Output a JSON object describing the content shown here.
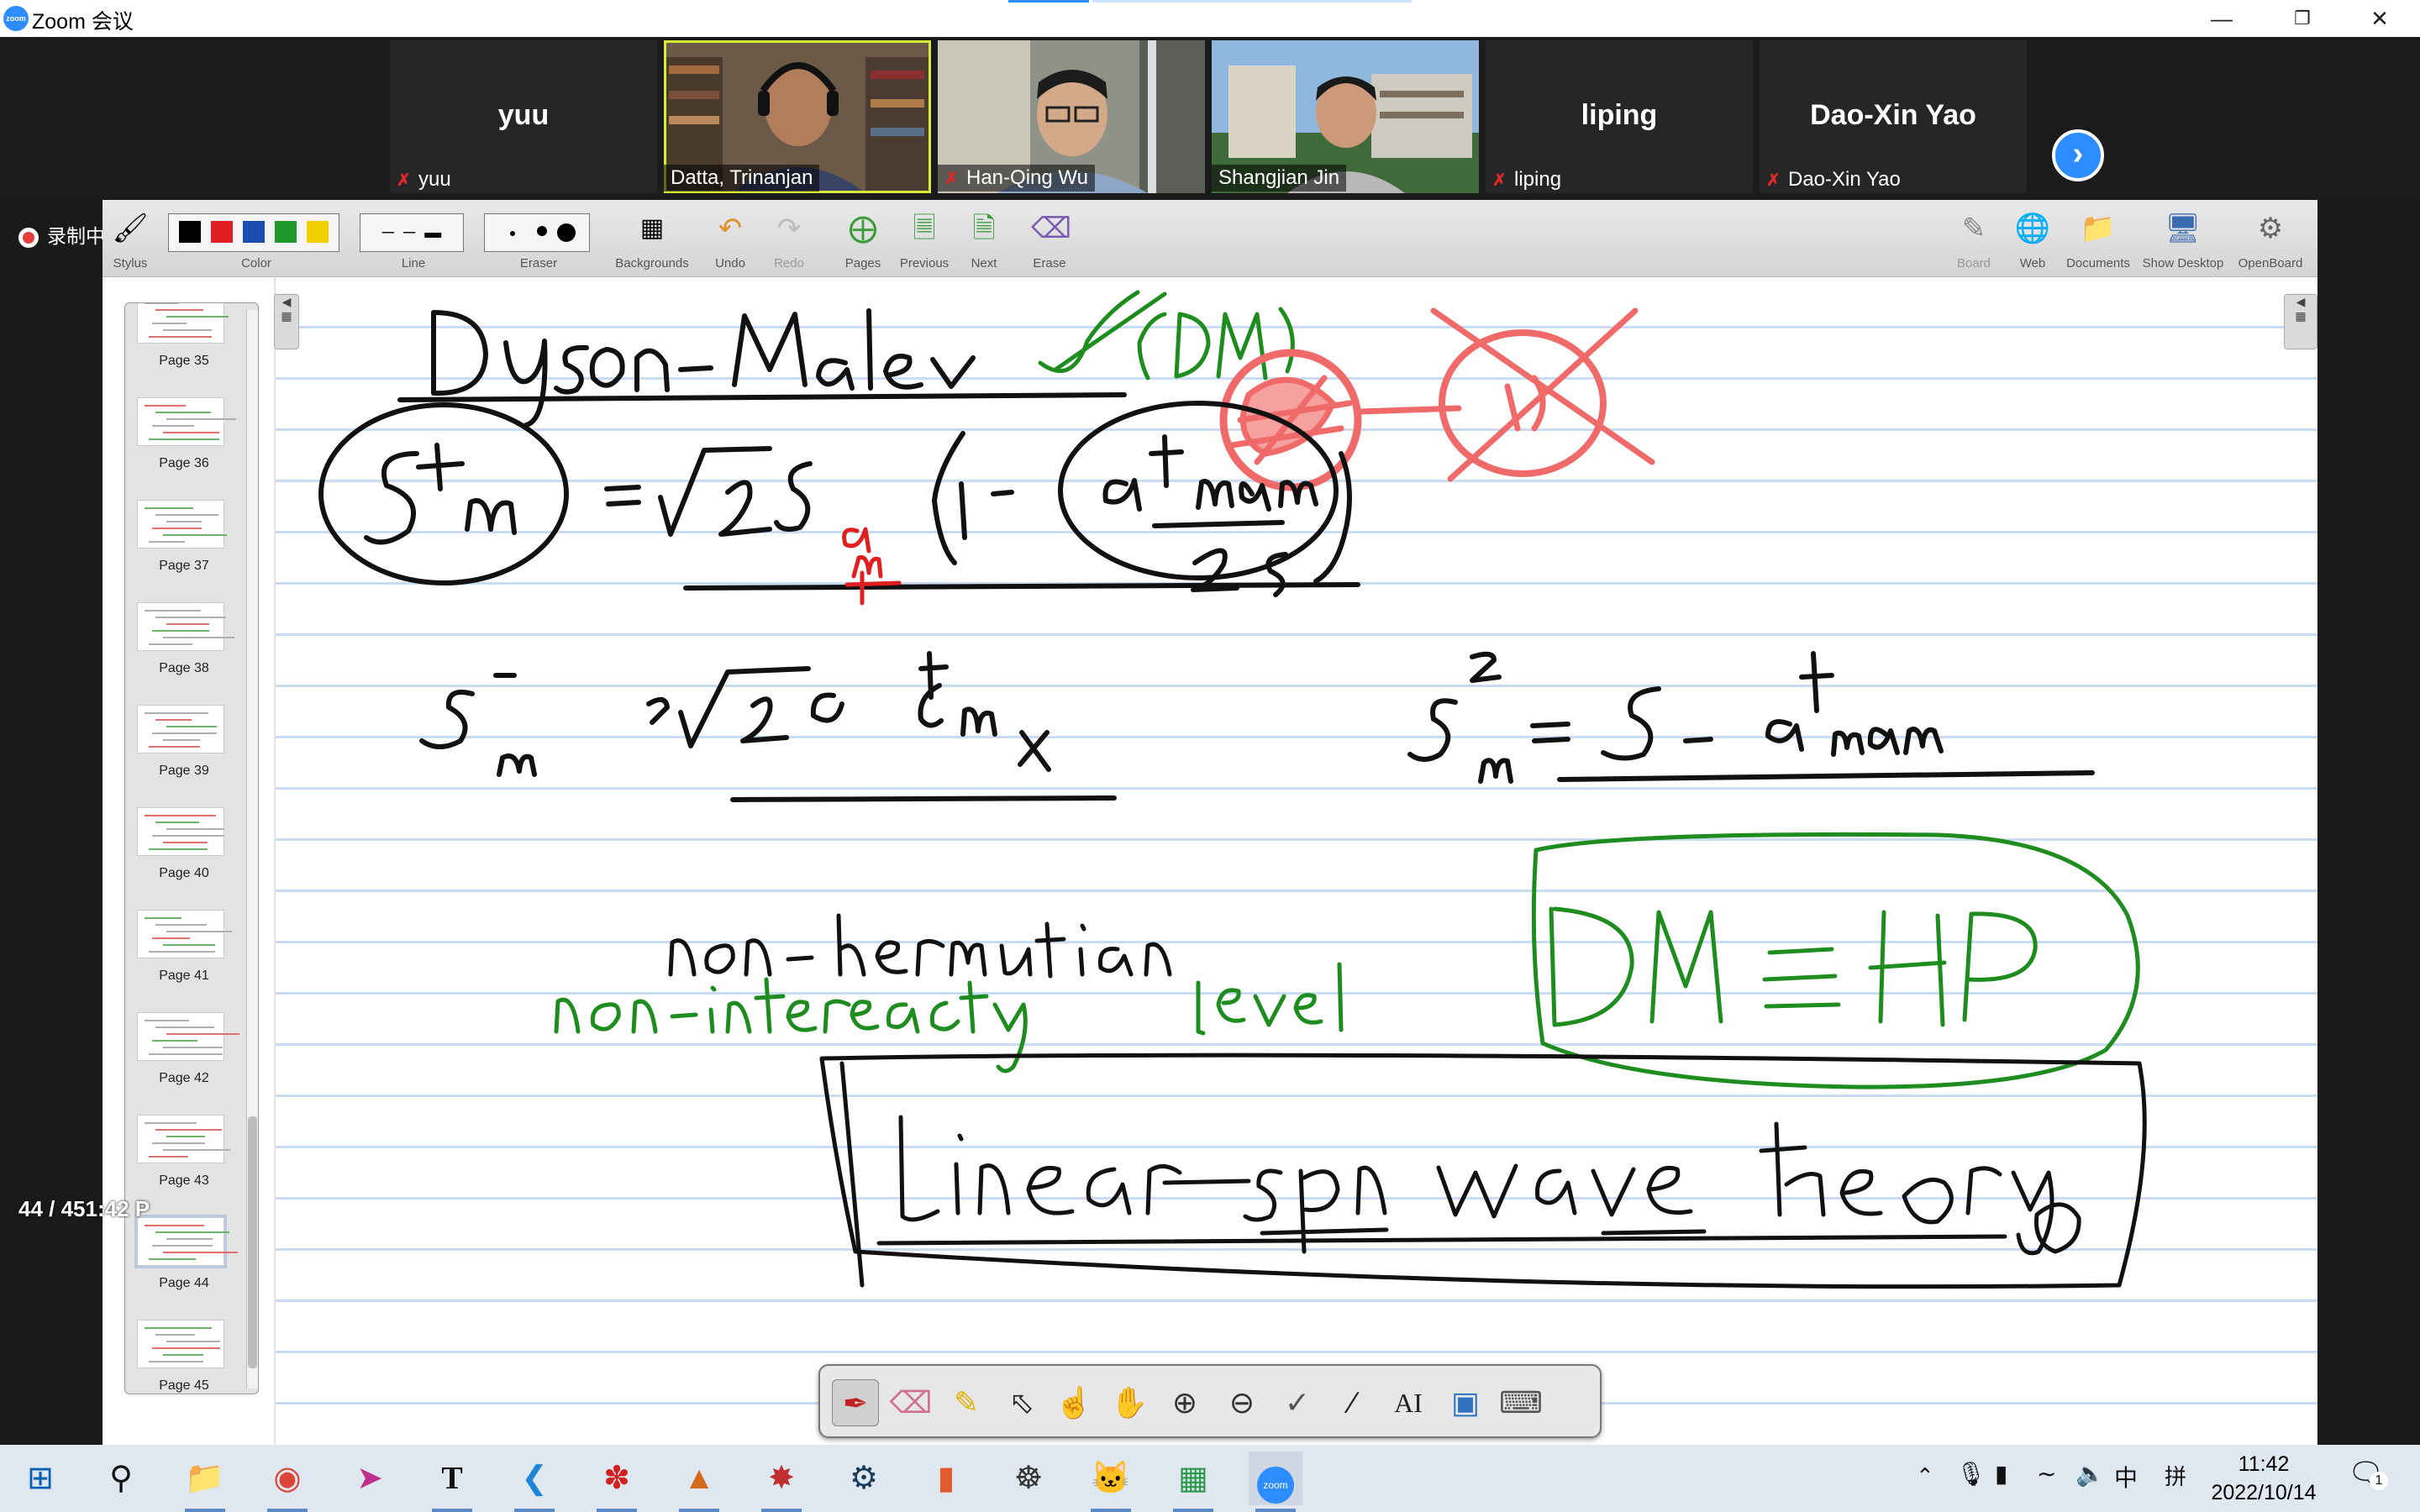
{
  "window": {
    "title": "Zoom 会议",
    "app_logo": "zoom",
    "controls": [
      "minimize-icon",
      "restore-icon",
      "close-icon"
    ]
  },
  "participants": [
    {
      "name": "yuu",
      "label": "yuu",
      "video": false,
      "muted": true
    },
    {
      "name": "Datta, Trinanjan",
      "label": "Datta, Trinanjan",
      "video": true,
      "muted": false,
      "active_speaker": true
    },
    {
      "name": "Han-Qing Wu",
      "label": "Han-Qing Wu",
      "video": true,
      "muted": true
    },
    {
      "name": "Shangjian Jin",
      "label": "Shangjian Jin",
      "video": true,
      "muted": false
    },
    {
      "name": "liping",
      "label": "liping",
      "video": false,
      "muted": true
    },
    {
      "name": "Dao-Xin Yao",
      "label": "Dao-Xin Yao",
      "video": false,
      "muted": true
    }
  ],
  "recording": {
    "label": "录制中"
  },
  "toolbar": {
    "stylus": "Stylus",
    "color": "Color",
    "line": "Line",
    "eraser": "Eraser",
    "backgrounds": "Backgrounds",
    "undo": "Undo",
    "redo": "Redo",
    "pages": "Pages",
    "previous": "Previous",
    "next": "Next",
    "erase": "Erase",
    "board": "Board",
    "web": "Web",
    "documents": "Documents",
    "show_desktop": "Show Desktop",
    "openboard": "OpenBoard",
    "colors": [
      "#000000",
      "#e02020",
      "#1a4fb0",
      "#1f9a2a",
      "#f0d000"
    ]
  },
  "pages": {
    "labels": [
      "Page 35",
      "Page 36",
      "Page 37",
      "Page 38",
      "Page 39",
      "Page 40",
      "Page 41",
      "Page 42",
      "Page 43",
      "Page 44",
      "Page 45"
    ],
    "counter": "44 / 45",
    "counter_suffix": "1:42 P",
    "current": "Page 44"
  },
  "taskbar": {
    "apps": [
      "windows-start-icon",
      "search-icon",
      "file-explorer-icon",
      "chrome-icon",
      "paper-plane-icon",
      "typora-icon",
      "vscode-icon",
      "huawei-icon",
      "matlab-icon",
      "mathematica-icon",
      "steam-icon",
      "powerpoint-icon",
      "settings-wheel-icon",
      "cat-app-icon",
      "green-app-icon",
      "zoom-icon"
    ],
    "tray": {
      "ime": "中",
      "ime2": "拼"
    },
    "time": "11:42",
    "date": "2022/10/14",
    "notifications": "1"
  }
}
